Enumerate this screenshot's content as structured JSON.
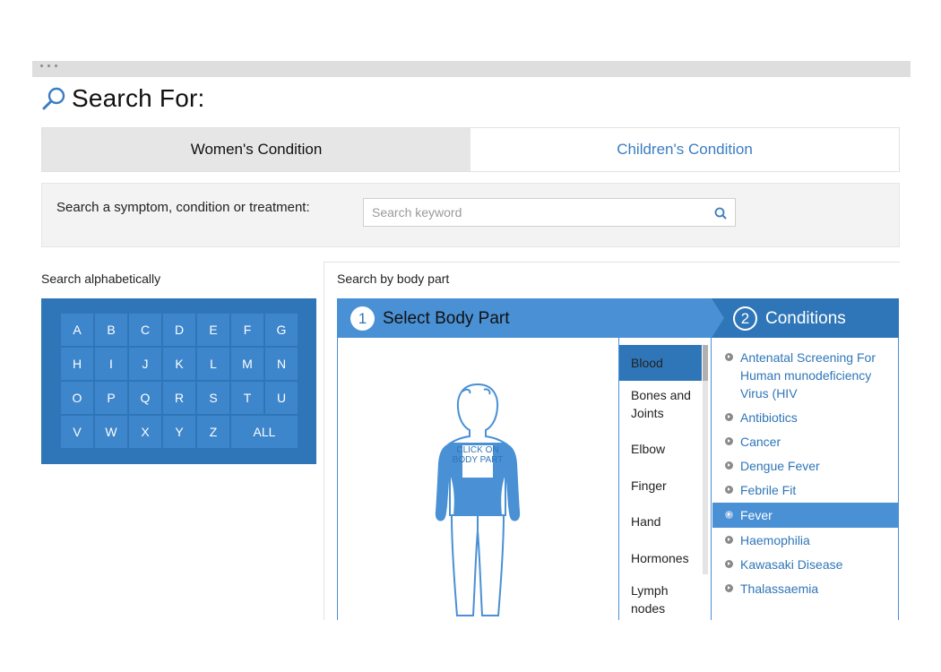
{
  "page": {
    "title": "Search For:",
    "search_icon": "magnifier-icon"
  },
  "tabs": [
    {
      "label": "Women's Condition",
      "active": true
    },
    {
      "label": "Children's Condition",
      "active": false
    }
  ],
  "search": {
    "label": "Search a symptom, condition or treatment:",
    "placeholder": "Search keyword",
    "value": "",
    "button_icon": "search-icon"
  },
  "alphabet": {
    "heading": "Search alphabetically",
    "letters": [
      "A",
      "B",
      "C",
      "D",
      "E",
      "F",
      "G",
      "H",
      "I",
      "J",
      "K",
      "L",
      "M",
      "N",
      "O",
      "P",
      "Q",
      "R",
      "S",
      "T",
      "U",
      "V",
      "W",
      "X",
      "Y",
      "Z",
      "ALL"
    ]
  },
  "body_part": {
    "heading": "Search by body part",
    "step1_number": "1",
    "step1_label": "Select Body Part",
    "step2_number": "2",
    "step2_label": "Conditions",
    "figure_hint": "CLICK ON BODY PART",
    "parts": [
      "Blood",
      "Bones and Joints",
      "Elbow",
      "Finger",
      "Hand",
      "Hormones",
      "Lymph nodes"
    ],
    "selected_part": "Blood"
  },
  "conditions": {
    "items": [
      "Antenatal Screening For Human munodeficiency Virus (HIV",
      "Antibiotics",
      "Cancer",
      "Dengue Fever",
      "Febrile Fit",
      "Fever",
      "Haemophilia",
      "Kawasaki Disease",
      "Thalassaemia"
    ],
    "selected": "Fever"
  },
  "colors": {
    "primary": "#2f76b8",
    "primary_light": "#4a90d4",
    "link": "#3a7dc3"
  }
}
